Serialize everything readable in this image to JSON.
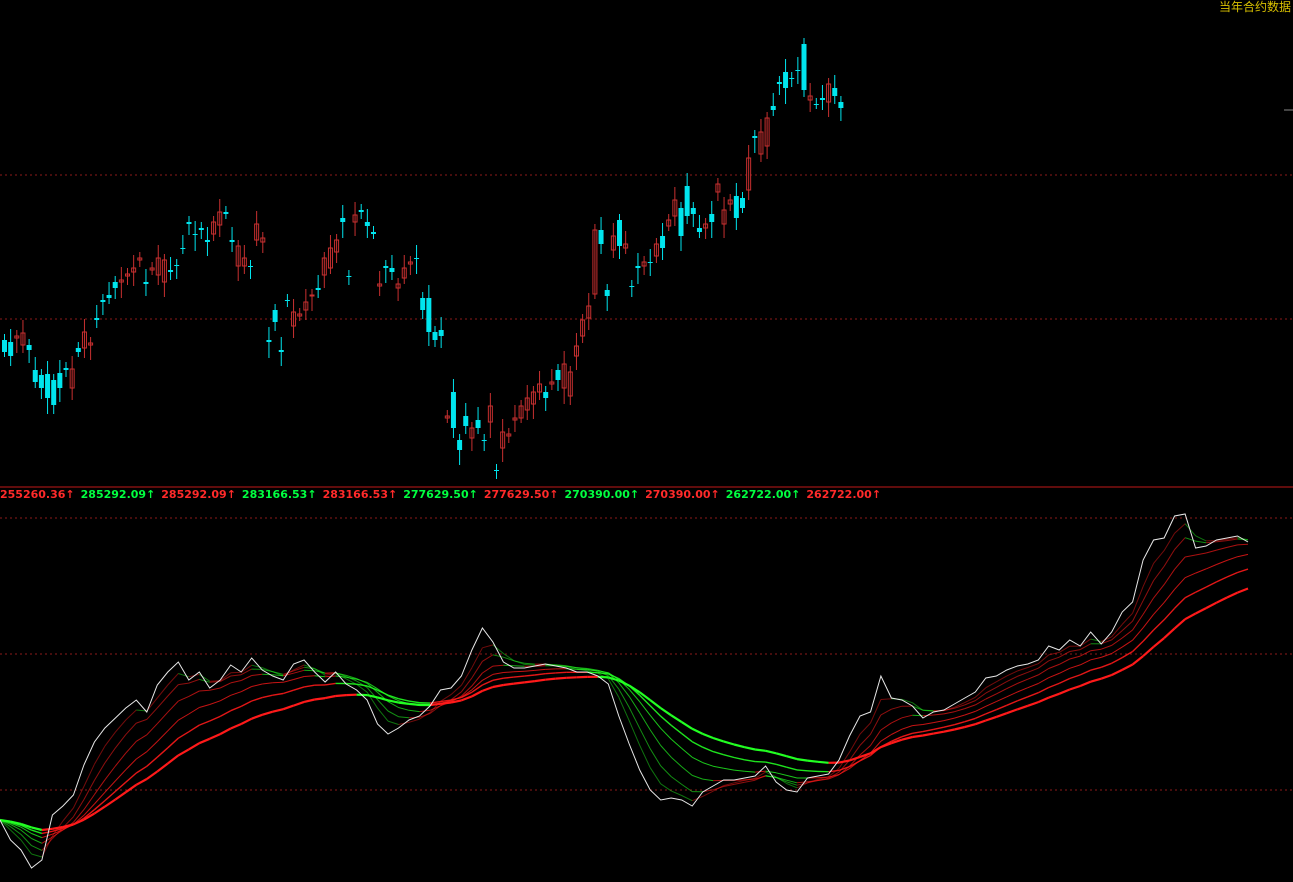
{
  "header": {
    "corner_label": "当年合约数据"
  },
  "indicator_legend": [
    {
      "text": "255260.36↑",
      "color": "#ff2a2a"
    },
    {
      "text": "285292.09↑",
      "color": "#00ff40"
    },
    {
      "text": "285292.09↑",
      "color": "#ff2a2a"
    },
    {
      "text": "283166.53↑",
      "color": "#00ff40"
    },
    {
      "text": "283166.53↑",
      "color": "#ff2a2a"
    },
    {
      "text": "277629.50↑",
      "color": "#00ff40"
    },
    {
      "text": "277629.50↑",
      "color": "#ff2a2a"
    },
    {
      "text": "270390.00↑",
      "color": "#00ff40"
    },
    {
      "text": "270390.00↑",
      "color": "#ff2a2a"
    },
    {
      "text": "262722.00↑",
      "color": "#00ff40"
    },
    {
      "text": "262722.00↑",
      "color": "#ff2a2a"
    }
  ],
  "colors": {
    "background": "#000000",
    "up_candle": "#c83030",
    "down_candle": "#00e5ee",
    "grid": "#8b1a1a",
    "price_line": "#e8e8e8",
    "ribbon_red": "#ff1a1a",
    "ribbon_green": "#22ff22"
  },
  "chart_data": [
    {
      "type": "candlestick",
      "grid": true,
      "ohlc_shape": [
        340,
        352,
        342,
        356,
        338,
        336,
        345,
        333,
        345,
        350,
        370,
        382,
        375,
        388,
        374,
        398,
        380,
        405,
        373,
        388,
        368,
        370,
        388,
        369,
        348,
        352,
        348,
        332,
        345,
        343,
        318,
        320,
        300,
        302,
        295,
        298,
        282,
        288,
        282,
        280,
        276,
        274,
        272,
        268,
        260,
        258,
        282,
        284,
        270,
        268,
        275,
        258,
        282,
        260,
        270,
        272,
        265,
        266,
        248,
        248,
        222,
        224,
        234,
        235,
        228,
        230,
        240,
        242,
        234,
        222,
        225,
        212,
        212,
        214,
        240,
        242,
        266,
        246,
        266,
        258,
        266,
        266,
        240,
        224,
        242,
        238,
        340,
        342,
        310,
        322,
        350,
        352,
        300,
        300,
        326,
        312,
        316,
        314,
        310,
        302,
        296,
        295,
        288,
        290,
        275,
        258,
        268,
        248,
        252,
        240,
        218,
        222,
        276,
        276,
        222,
        215,
        210,
        212,
        222,
        226,
        232,
        234,
        286,
        284,
        266,
        268,
        268,
        272,
        288,
        284,
        278,
        268,
        264,
        262,
        258,
        258,
        298,
        310,
        298,
        332,
        332,
        340,
        330,
        336,
        418,
        416,
        392,
        428,
        440,
        450,
        416,
        426,
        438,
        428,
        420,
        428,
        440,
        440,
        422,
        406,
        470,
        470,
        448,
        432,
        436,
        434,
        420,
        418,
        418,
        406,
        410,
        398,
        404,
        392,
        392,
        384,
        392,
        398,
        384,
        382,
        370,
        380,
        388,
        364,
        396,
        372,
        356,
        346,
        336,
        320,
        318,
        306,
        294,
        230,
        230,
        244,
        290,
        296,
        250,
        236,
        220,
        246,
        248,
        244,
        286,
        286,
        266,
        268,
        266,
        262,
        262,
        262,
        256,
        244,
        236,
        248,
        226,
        220,
        216,
        200,
        208,
        236,
        186,
        216,
        208,
        214,
        228,
        232,
        228,
        224,
        214,
        222,
        192,
        184,
        224,
        210,
        204,
        200,
        196,
        218,
        198,
        208,
        190,
        158,
        136,
        138,
        154,
        132,
        146,
        118,
        106,
        110,
        82,
        84,
        72,
        88,
        78,
        78,
        70,
        70,
        44,
        90,
        100,
        96,
        104,
        104,
        98,
        100,
        102,
        84,
        88,
        96,
        102,
        108,
        92
      ],
      "scale_note": "values relative to chart pane; y increases downward"
    },
    {
      "type": "line",
      "series": [
        {
          "values": [
            820,
            840,
            850,
            868,
            860,
            815,
            806,
            795,
            765,
            742,
            728,
            718,
            708,
            700,
            712,
            685,
            672,
            662,
            680,
            672,
            688,
            680,
            665,
            672,
            658,
            670,
            676,
            680,
            664,
            660,
            672,
            682,
            672,
            684,
            690,
            700,
            724,
            734,
            728,
            720,
            716,
            706,
            690,
            688,
            676,
            650,
            628,
            642,
            662,
            668,
            668,
            666,
            664,
            666,
            668,
            672,
            672,
            676,
            684,
            716,
            744,
            770,
            790,
            800,
            798,
            800,
            806,
            792,
            786,
            780,
            780,
            778,
            776,
            766,
            782,
            790,
            792,
            778,
            776,
            774,
            760,
            736,
            716,
            712,
            676,
            698,
            700,
            706,
            718,
            712,
            710,
            704,
            698,
            692,
            678,
            676,
            670,
            666,
            664,
            660,
            646,
            650,
            640,
            646,
            632,
            644,
            632,
            612,
            602,
            560,
            540,
            538,
            516,
            514,
            548,
            546,
            540,
            538,
            536,
            542
          ]
        }
      ]
    }
  ]
}
